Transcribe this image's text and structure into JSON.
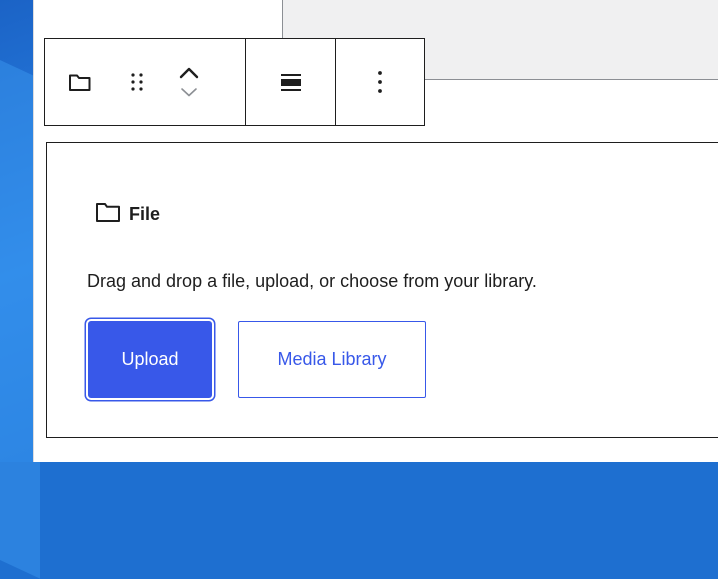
{
  "toolbar": {
    "block_type_icon": "folder-icon",
    "drag_icon": "drag-handle-icon",
    "move_up_icon": "chevron-up-icon",
    "move_down_icon": "chevron-down-icon",
    "align_icon": "align-wide-icon",
    "options_icon": "more-vertical-icon"
  },
  "file_block": {
    "icon": "folder-icon",
    "label": "File",
    "instructions": "Drag and drop a file, upload, or choose from your library.",
    "upload_button": "Upload",
    "media_library_button": "Media Library"
  },
  "colors": {
    "accent": "#3858e9",
    "text": "#1e1e1e",
    "desktop_blue": "#1e6fd0"
  }
}
